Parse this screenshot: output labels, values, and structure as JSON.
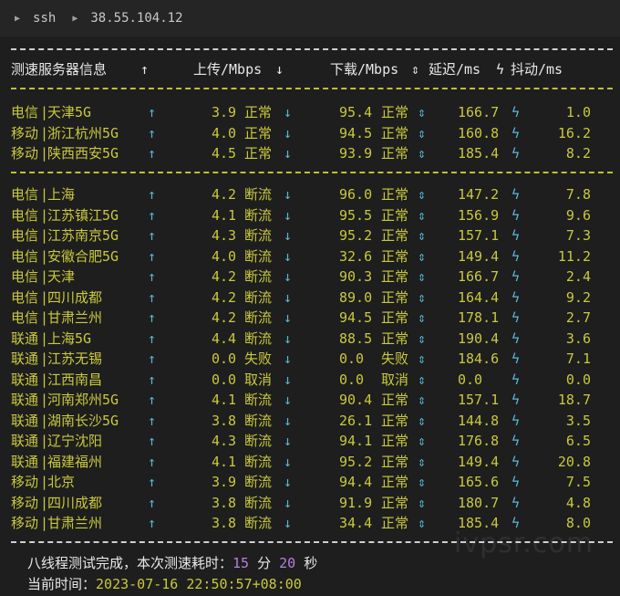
{
  "titlebar": {
    "app": "ssh",
    "host": "38.55.104.12"
  },
  "header": {
    "server": "测速服务器信息",
    "up_arrow": "↑",
    "upload": "上传/Mbps",
    "down_arrow": "↓",
    "download": "下载/Mbps",
    "updown": "⇕",
    "latency": "延迟/ms",
    "bolt": "ϟ",
    "jitter": "抖动/ms"
  },
  "groups": [
    [
      {
        "isp": "电信",
        "city": "天津5G",
        "upload": "3.9",
        "up_status": "正常",
        "download": "95.4",
        "down_status": "正常",
        "latency": "166.7",
        "jitter": "1.0"
      },
      {
        "isp": "移动",
        "city": "浙江杭州5G",
        "upload": "4.0",
        "up_status": "正常",
        "download": "94.5",
        "down_status": "正常",
        "latency": "160.8",
        "jitter": "16.2"
      },
      {
        "isp": "移动",
        "city": "陕西西安5G",
        "upload": "4.5",
        "up_status": "正常",
        "download": "93.9",
        "down_status": "正常",
        "latency": "185.4",
        "jitter": "8.2"
      }
    ],
    [
      {
        "isp": "电信",
        "city": "上海",
        "upload": "4.2",
        "up_status": "断流",
        "download": "96.0",
        "down_status": "正常",
        "latency": "147.2",
        "jitter": "7.8"
      },
      {
        "isp": "电信",
        "city": "江苏镇江5G",
        "upload": "4.1",
        "up_status": "断流",
        "download": "95.5",
        "down_status": "正常",
        "latency": "156.9",
        "jitter": "9.6"
      },
      {
        "isp": "电信",
        "city": "江苏南京5G",
        "upload": "4.3",
        "up_status": "断流",
        "download": "95.2",
        "down_status": "正常",
        "latency": "157.1",
        "jitter": "7.3"
      },
      {
        "isp": "电信",
        "city": "安徽合肥5G",
        "upload": "4.0",
        "up_status": "断流",
        "download": "32.6",
        "down_status": "正常",
        "latency": "149.4",
        "jitter": "11.2"
      },
      {
        "isp": "电信",
        "city": "天津",
        "upload": "4.2",
        "up_status": "断流",
        "download": "90.3",
        "down_status": "正常",
        "latency": "166.7",
        "jitter": "2.4"
      },
      {
        "isp": "电信",
        "city": "四川成都",
        "upload": "4.2",
        "up_status": "断流",
        "download": "89.0",
        "down_status": "正常",
        "latency": "164.4",
        "jitter": "9.2"
      },
      {
        "isp": "电信",
        "city": "甘肃兰州",
        "upload": "4.2",
        "up_status": "断流",
        "download": "94.5",
        "down_status": "正常",
        "latency": "178.1",
        "jitter": "2.7"
      },
      {
        "isp": "联通",
        "city": "上海5G",
        "upload": "4.4",
        "up_status": "断流",
        "download": "88.5",
        "down_status": "正常",
        "latency": "190.4",
        "jitter": "3.6"
      },
      {
        "isp": "联通",
        "city": "江苏无锡",
        "upload": "0.0",
        "up_status": "失败",
        "download": "0.0",
        "down_status": "失败",
        "latency": "184.6",
        "jitter": "7.1"
      },
      {
        "isp": "联通",
        "city": "江西南昌",
        "upload": "0.0",
        "up_status": "取消",
        "download": "0.0",
        "down_status": "取消",
        "latency": "0.0",
        "jitter": "0.0"
      },
      {
        "isp": "联通",
        "city": "河南郑州5G",
        "upload": "4.1",
        "up_status": "断流",
        "download": "90.4",
        "down_status": "正常",
        "latency": "157.1",
        "jitter": "18.7"
      },
      {
        "isp": "联通",
        "city": "湖南长沙5G",
        "upload": "3.8",
        "up_status": "断流",
        "download": "26.1",
        "down_status": "正常",
        "latency": "144.8",
        "jitter": "3.5"
      },
      {
        "isp": "联通",
        "city": "辽宁沈阳",
        "upload": "4.3",
        "up_status": "断流",
        "download": "94.1",
        "down_status": "正常",
        "latency": "176.8",
        "jitter": "6.5"
      },
      {
        "isp": "联通",
        "city": "福建福州",
        "upload": "4.1",
        "up_status": "断流",
        "download": "95.2",
        "down_status": "正常",
        "latency": "149.4",
        "jitter": "20.8"
      },
      {
        "isp": "移动",
        "city": "北京",
        "upload": "3.9",
        "up_status": "断流",
        "download": "94.4",
        "down_status": "正常",
        "latency": "165.6",
        "jitter": "7.5"
      },
      {
        "isp": "移动",
        "city": "四川成都",
        "upload": "3.8",
        "up_status": "断流",
        "download": "91.9",
        "down_status": "正常",
        "latency": "180.7",
        "jitter": "4.8"
      },
      {
        "isp": "移动",
        "city": "甘肃兰州",
        "upload": "3.8",
        "up_status": "断流",
        "download": "34.4",
        "down_status": "正常",
        "latency": "185.4",
        "jitter": "8.0"
      }
    ]
  ],
  "footer": {
    "done_text": "八线程测试完成，本次测速耗时：",
    "minutes": "15",
    "min_unit": "分",
    "seconds": "20",
    "sec_unit": "秒",
    "time_label": "当前时间：",
    "time_value": "2023-07-16 22:50:57+08:00"
  },
  "watermark": "ivpsr.com"
}
